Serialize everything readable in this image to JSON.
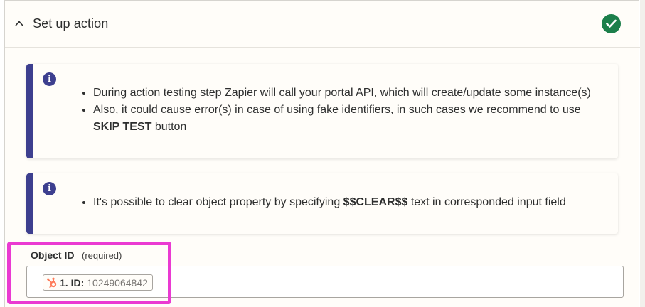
{
  "section": {
    "title": "Set up action",
    "status": "complete"
  },
  "info_boxes": [
    {
      "items": [
        {
          "text": "During action testing step Zapier will call your portal API, which will create/update some instance(s)"
        },
        {
          "text_before": "Also, it could cause error(s) in case of using fake identifiers, in such cases we recommend to use ",
          "bold": "SKIP TEST",
          "text_after": " button"
        }
      ]
    },
    {
      "items": [
        {
          "text_before": "It's possible to clear object property by specifying ",
          "bold": "$$CLEAR$$",
          "text_after": " text in corresponded input field"
        }
      ]
    }
  ],
  "field": {
    "label": "Object ID",
    "required_label": "(required)",
    "token": {
      "icon": "hubspot-icon",
      "label": "1. ID:",
      "value": "10249064842"
    }
  },
  "colors": {
    "accent": "#3d3f8f",
    "success": "#1c7f4b",
    "highlight": "#ea3ad2",
    "hubspot": "#ff7a59"
  }
}
